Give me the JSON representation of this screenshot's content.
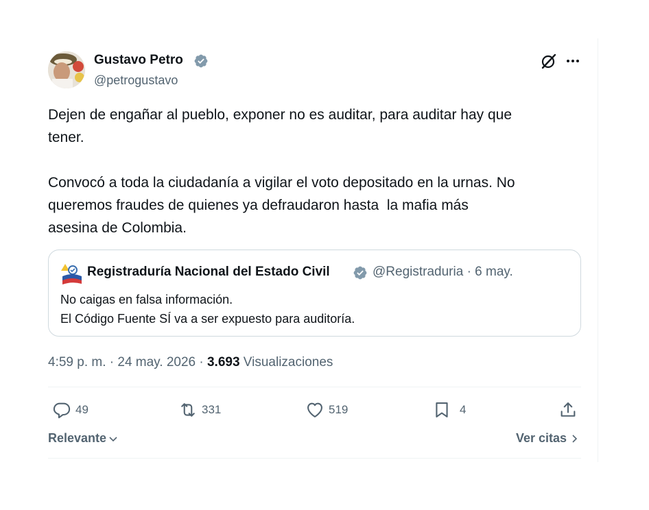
{
  "author": {
    "name": "Gustavo Petro",
    "handle": "@petrogustavo"
  },
  "tweet": {
    "text": "Dejen de engañar al pueblo, exponer no es auditar, para auditar hay que\ntener.\n\nConvocó a toda la ciudadanía a vigilar el voto depositado en la urnas. No\nqueremos fraudes de quienes ya defraudaron hasta  la mafia más\nasesina de Colombia."
  },
  "quote": {
    "name": "Registraduría Nacional del Estado Civil",
    "meta": "@Registraduria · 6 may.",
    "text": "No caigas en falsa información.\nEl Código Fuente SÍ va a ser expuesto para auditoría."
  },
  "meta": {
    "time_date": "4:59 p. m. · 24 may. 2026 · ",
    "views_count": "3.693",
    "views_label": " Visualizaciones"
  },
  "actions": {
    "replies": "49",
    "retweets": "331",
    "likes": "519",
    "bookmarks": "4"
  },
  "footer": {
    "sort_label": "Relevante",
    "quotes_label": "Ver citas"
  },
  "colors": {
    "verified": "#829aab",
    "text_secondary": "#536471",
    "border": "#cfd9de"
  }
}
